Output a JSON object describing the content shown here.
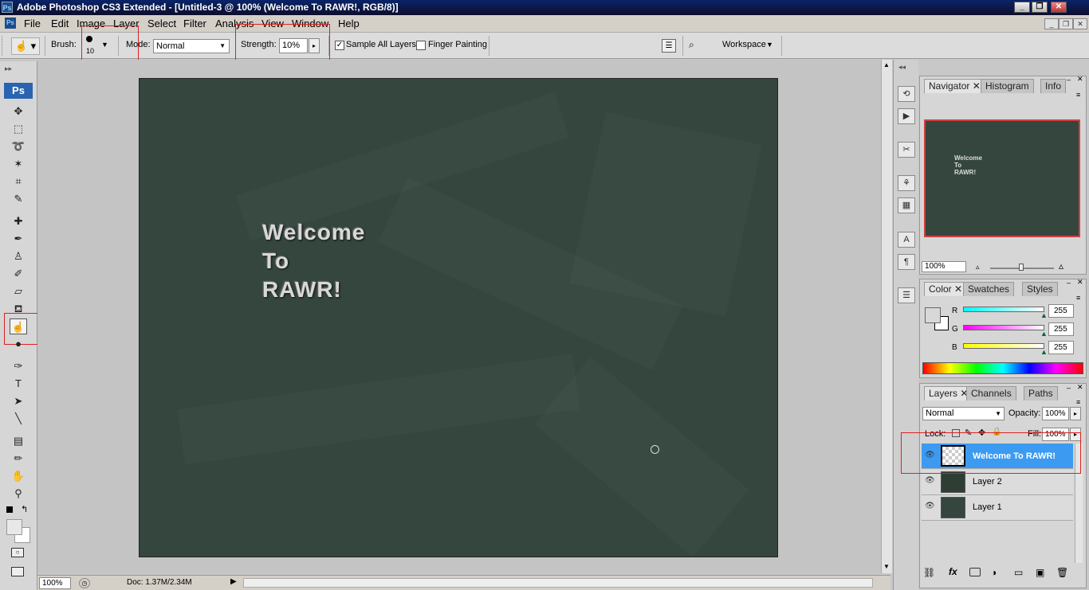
{
  "app": {
    "title": "Adobe Photoshop CS3 Extended - [Untitled-3 @ 100% (Welcome To RAWR!, RGB/8)]",
    "logo": "Ps"
  },
  "menu": [
    "File",
    "Edit",
    "Image",
    "Layer",
    "Select",
    "Filter",
    "Analysis",
    "View",
    "Window",
    "Help"
  ],
  "options": {
    "brush_label": "Brush:",
    "brush_size": "10",
    "mode_label": "Mode:",
    "mode_value": "Normal",
    "strength_label": "Strength:",
    "strength_value": "10%",
    "sample_all_layers": "Sample All Layers",
    "finger_painting": "Finger Painting",
    "workspace": "Workspace"
  },
  "canvas": {
    "text_lines": [
      "Welcome",
      "To",
      "RAWR!"
    ],
    "background": "#34463d"
  },
  "status": {
    "zoom": "100%",
    "doc": "Doc: 1.37M/2.34M"
  },
  "navigator": {
    "tabs": [
      "Navigator",
      "Histogram",
      "Info"
    ],
    "zoom": "100%",
    "thumb_text": [
      "Welcome",
      "To",
      "RAWR!"
    ]
  },
  "color": {
    "tabs": [
      "Color",
      "Swatches",
      "Styles"
    ],
    "channels": [
      {
        "label": "R",
        "value": "255"
      },
      {
        "label": "G",
        "value": "255"
      },
      {
        "label": "B",
        "value": "255"
      }
    ]
  },
  "layers": {
    "tabs": [
      "Layers",
      "Channels",
      "Paths"
    ],
    "blend_mode": "Normal",
    "opacity_label": "Opacity:",
    "opacity": "100%",
    "lock_label": "Lock:",
    "fill_label": "Fill:",
    "fill": "100%",
    "items": [
      {
        "name": "Welcome To RAWR!",
        "selected": true
      },
      {
        "name": "Layer 2",
        "selected": false
      },
      {
        "name": "Layer 1",
        "selected": false
      }
    ]
  }
}
